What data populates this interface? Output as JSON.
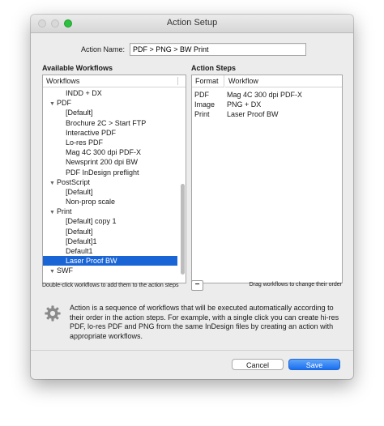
{
  "window": {
    "title": "Action Setup"
  },
  "action_name": {
    "label": "Action Name:",
    "value": "PDF > PNG > BW Print"
  },
  "available": {
    "title": "Available Workflows",
    "column_header": "Workflows",
    "rows": [
      {
        "label": "INDD + DX",
        "kind": "item"
      },
      {
        "label": "PDF",
        "kind": "group",
        "expanded": true
      },
      {
        "label": "[Default]",
        "kind": "item"
      },
      {
        "label": "Brochure 2C > Start FTP",
        "kind": "item"
      },
      {
        "label": "Interactive PDF",
        "kind": "item"
      },
      {
        "label": "Lo-res PDF",
        "kind": "item"
      },
      {
        "label": "Mag 4C 300 dpi PDF-X",
        "kind": "item"
      },
      {
        "label": "Newsprint 200 dpi BW",
        "kind": "item"
      },
      {
        "label": "PDF InDesign preflight",
        "kind": "item"
      },
      {
        "label": "PostScript",
        "kind": "group",
        "expanded": true
      },
      {
        "label": "[Default]",
        "kind": "item"
      },
      {
        "label": "Non-prop scale",
        "kind": "item"
      },
      {
        "label": "Print",
        "kind": "group",
        "expanded": true
      },
      {
        "label": "[Default] copy 1",
        "kind": "item"
      },
      {
        "label": "[Default]",
        "kind": "item"
      },
      {
        "label": "[Default]1",
        "kind": "item"
      },
      {
        "label": "Default1",
        "kind": "item"
      },
      {
        "label": "Laser Proof BW",
        "kind": "item",
        "selected": true
      },
      {
        "label": "SWF",
        "kind": "group",
        "expanded": true
      }
    ],
    "hint": "Double-click workflows to add them to the action steps"
  },
  "steps": {
    "title": "Action Steps",
    "col_format": "Format",
    "col_workflow": "Workflow",
    "rows": [
      {
        "format": "PDF",
        "workflow": "Mag 4C 300 dpi PDF-X"
      },
      {
        "format": "Image",
        "workflow": "PNG + DX"
      },
      {
        "format": "Print",
        "workflow": "Laser Proof BW"
      }
    ],
    "remove_label": "−",
    "hint": "Drag workflows to change their order"
  },
  "description": "Action is a sequence of workflows that will be executed automatically according to their order in the action steps. For example, with a single click you can create hi-res PDF, lo-res PDF and PNG from the same InDesign files by creating an action with appropriate workflows.",
  "buttons": {
    "cancel": "Cancel",
    "save": "Save"
  },
  "colors": {
    "selection": "#1a65d6",
    "save_button": "#1a6ff2",
    "zoom_light": "#2dc13f"
  }
}
